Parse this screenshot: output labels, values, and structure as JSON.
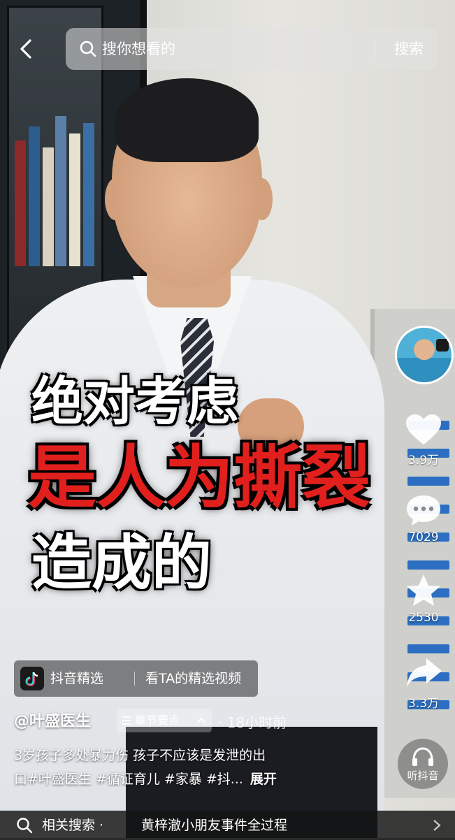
{
  "search": {
    "placeholder": "搜你想看的",
    "button_label": "搜索"
  },
  "captions": {
    "line1": "绝对考虑",
    "line2": "是人为撕裂",
    "line3": "造成的"
  },
  "actions": {
    "like_count": "3.9万",
    "comment_count": "7029",
    "favorite_count": "2530",
    "share_count": "3.3万"
  },
  "featured": {
    "name": "抖音精选",
    "link": "看TA的精选视频"
  },
  "author": {
    "handle": "@叶盛医生",
    "chapter_label": "章节要点",
    "time": "· 18小时前"
  },
  "description": {
    "line1": "3岁孩子多处暴力伤 孩子不应该是发泄的出",
    "line2": "口#叶盛医生 #循证育儿 #家暴 #抖...",
    "expand": "展开"
  },
  "listen": {
    "label": "听抖音"
  },
  "related": {
    "prefix": "相关搜索 ·",
    "query": "黄梓澈小朋友事件全过程"
  },
  "colors": {
    "caption_red": "#e1201e",
    "caption_white": "#ffffff"
  }
}
